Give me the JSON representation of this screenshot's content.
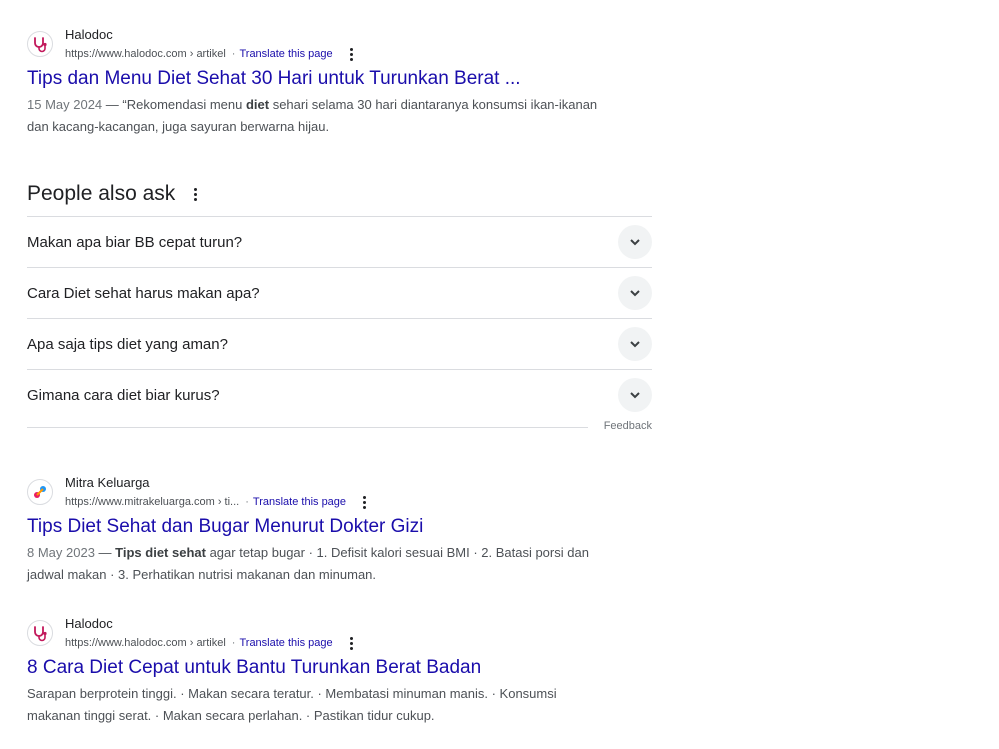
{
  "results": [
    {
      "site_name": "Halodoc",
      "url": "https://www.halodoc.com › artikel",
      "translate": "Translate this page",
      "separator": "·",
      "title": "Tips dan Menu Diet Sehat 30 Hari untuk Turunkan Berat ...",
      "date": "15 May 2024",
      "dash": " — ",
      "snippet_pre": "“Rekomendasi menu ",
      "snippet_bold": "diet",
      "snippet_post": " sehari selama 30 hari diantaranya konsumsi ikan-ikanan dan kacang-kacangan, juga sayuran berwarna hijau.",
      "favicon": "halodoc-stethoscope-icon"
    },
    {
      "site_name": "Mitra Keluarga",
      "url": "https://www.mitrakeluarga.com › ti...",
      "translate": "Translate this page",
      "separator": "·",
      "title": "Tips Diet Sehat dan Bugar Menurut Dokter Gizi",
      "date": "8 May 2023",
      "dash": " — ",
      "snippet_pre": "",
      "snippet_bold": "Tips diet sehat",
      "snippet_post": " agar tetap bugar · 1. Defisit kalori sesuai BMI · 2. Batasi porsi dan jadwal makan · 3. Perhatikan nutrisi makanan dan minuman.",
      "favicon": "mitra-keluarga-logo-icon"
    },
    {
      "site_name": "Halodoc",
      "url": "https://www.halodoc.com › artikel",
      "translate": "Translate this page",
      "separator": "·",
      "title": "8 Cara Diet Cepat untuk Bantu Turunkan Berat Badan",
      "snippet_text": "Sarapan berprotein tinggi. · Makan secara teratur. · Membatasi minuman manis. · Konsumsi makanan tinggi serat. · Makan secara perlahan. · Pastikan tidur cukup.",
      "favicon": "halodoc-stethoscope-icon"
    }
  ],
  "people_also_ask": {
    "title": "People also ask",
    "questions": [
      "Makan apa biar BB cepat turun?",
      "Cara Diet sehat harus makan apa?",
      "Apa saja tips diet yang aman?",
      "Gimana cara diet biar kurus?"
    ],
    "feedback": "Feedback"
  },
  "colors": {
    "link": "#1a0dab",
    "text": "#202124",
    "snippet": "#4d5156",
    "halodoc_brand": "#c2185b"
  }
}
